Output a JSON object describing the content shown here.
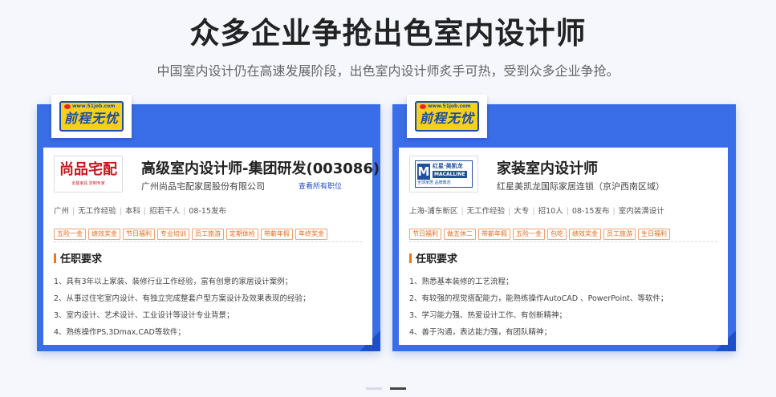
{
  "header": {
    "title": "众多企业争抢出色室内设计师",
    "subtitle": "中国室内设计仍在高速发展阶段，出色室内设计师炙手可热，受到众多企业争抢。"
  },
  "brand": {
    "url": "www.51job.com",
    "name": "前程无忧"
  },
  "cards": [
    {
      "logo": {
        "main": "尚品宅配",
        "sub": "全屋家具 定制专家"
      },
      "title": "高级室内设计师-集团研发(003086)",
      "company": "广州尚品宅配家居股份有限公司",
      "view_all": "查看所有职位",
      "meta": [
        "广州",
        "无工作经验",
        "本科",
        "招若干人",
        "08-15发布"
      ],
      "tags": [
        "五险一金",
        "绩效奖金",
        "节日福利",
        "专业培训",
        "员工旅游",
        "定期体检",
        "带薪年假",
        "年终奖金"
      ],
      "requirements_title": "任职要求",
      "requirements": [
        "1、具有3年以上家装、装修行业工作经验，富有创意的家居设计案例；",
        "2、从事过住宅室内设计、有独立完成整套户型方案设计及效果表现的经验；",
        "3、室内设计、艺术设计、工业设计等设计专业背景；",
        "4、熟练操作PS,3Dmax,CAD等软件；"
      ]
    },
    {
      "logo": {
        "main": "M",
        "cn": "红星·美凯龙",
        "en": "MACALLINE",
        "sub": "全球家居 品牌典范"
      },
      "title": "家装室内设计师",
      "company": "红星美凯龙国际家居连锁（京沪西南区域）",
      "view_all": "",
      "meta": [
        "上海-浦东新区",
        "无工作经验",
        "大专",
        "招10人",
        "08-15发布",
        "室内装潢设计"
      ],
      "tags": [
        "节日福利",
        "做五休二",
        "带薪年假",
        "五险一金",
        "包吃",
        "绩效奖金",
        "员工旅游",
        "生日福利"
      ],
      "requirements_title": "任职要求",
      "requirements": [
        "1、熟悉基本装修的工艺流程；",
        "2、有较强的视觉搭配能力，能熟练操作AutoCAD 、PowerPoint、等软件；",
        "3、学习能力强、热爱设计工作、有创新精神；",
        "4、善于沟通，表达能力强，有团队精神；"
      ]
    }
  ],
  "pager": {
    "count": 2,
    "active_index": 1
  },
  "colors": {
    "card_blue": "#3a6ee8",
    "accent_orange": "#e87722",
    "tag_orange": "#e06a1b"
  }
}
